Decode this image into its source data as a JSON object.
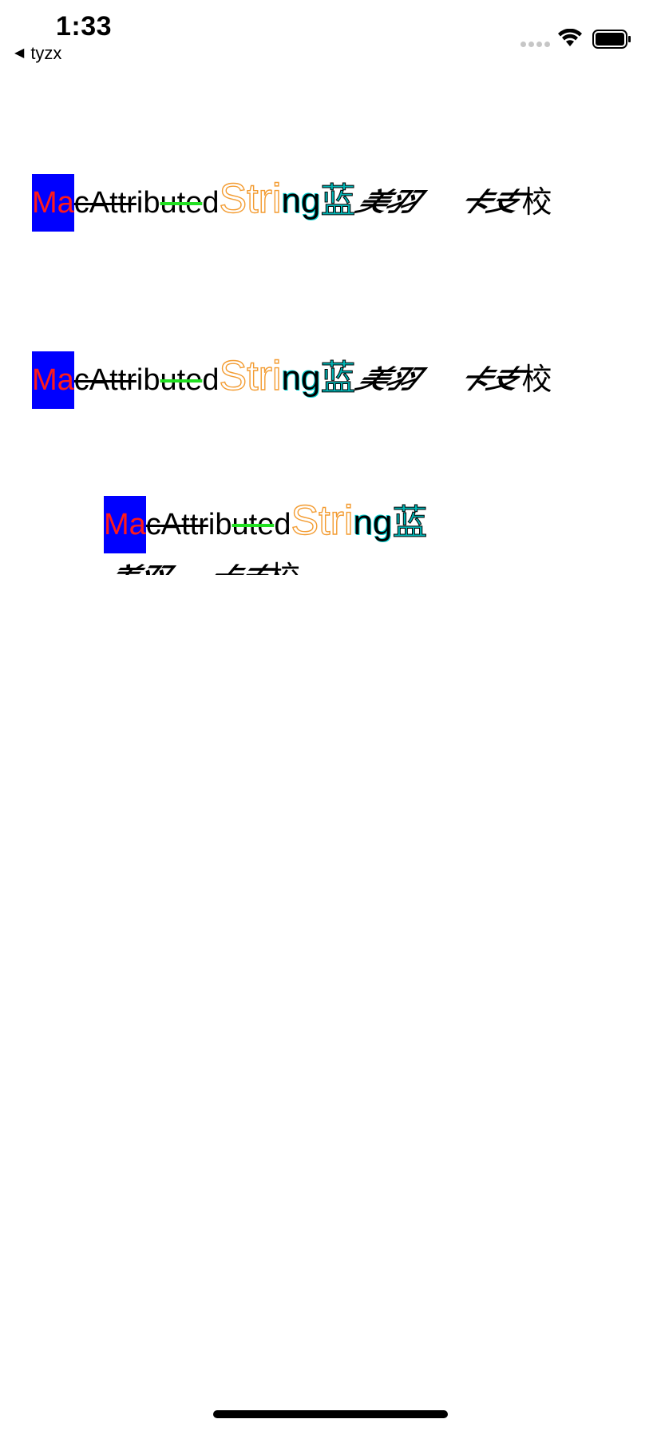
{
  "status_bar": {
    "time": "1:33",
    "back_label": "tyzx",
    "back_icon": "back-triangle-icon",
    "signal_icon": "cellular-signal-icon",
    "wifi_icon": "wifi-icon",
    "battery_icon": "battery-icon"
  },
  "attributed_text": {
    "seg_blue": "Ma",
    "seg_strike": "cAttr",
    "seg_plain_1": "ib",
    "seg_green": "ute",
    "seg_plain_2": "d",
    "seg_outline": "Stri",
    "seg_cyan_ng": "ng",
    "seg_cyan_cjk": "蓝",
    "seg_skew_1": "美羽",
    "seg_skew_2": "卡支",
    "seg_last": "校"
  },
  "colors": {
    "highlight_background": "#0000ff",
    "highlight_text": "#ff1a1a",
    "underline_green": "#22e022",
    "outline_orange": "#f39c32",
    "stroke_cyan": "#00cccc"
  }
}
